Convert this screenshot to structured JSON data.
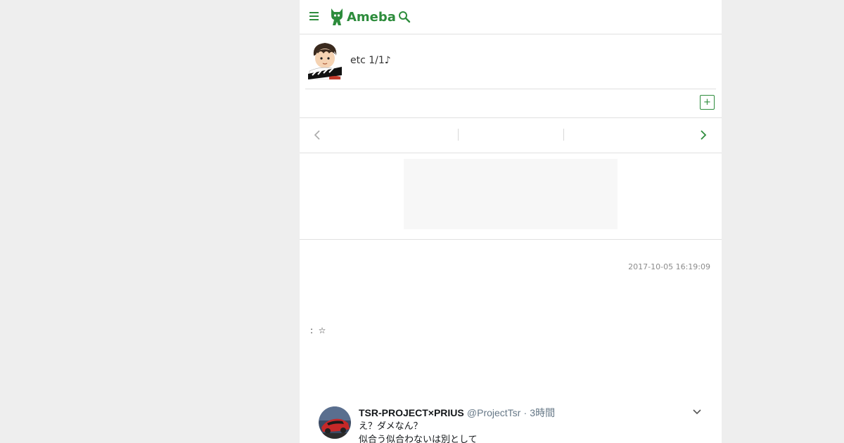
{
  "header": {
    "logo_text": "Ameba",
    "icons": {
      "menu": "hamburger-menu-icon",
      "logo": "ameba-mascot-icon",
      "search": "search-icon"
    },
    "brand_color": "#2d8c3c"
  },
  "blog": {
    "title": "etc 1/1♪",
    "follow_label": "+"
  },
  "nav": {
    "prev_icon": "chevron-left-icon",
    "next_icon": "chevron-right-icon"
  },
  "article": {
    "timestamp": "2017-10-05 16:19:09",
    "body_line": ":  ☆"
  },
  "tweet": {
    "name": "TSR-PROJECT×PRIUS",
    "handle": "@ProjectTsr",
    "separator": "·",
    "time": "3時間",
    "lines": [
      "え？ダメなん？",
      "似合う似合わないは別として"
    ],
    "menu_icon": "chevron-down-icon"
  }
}
